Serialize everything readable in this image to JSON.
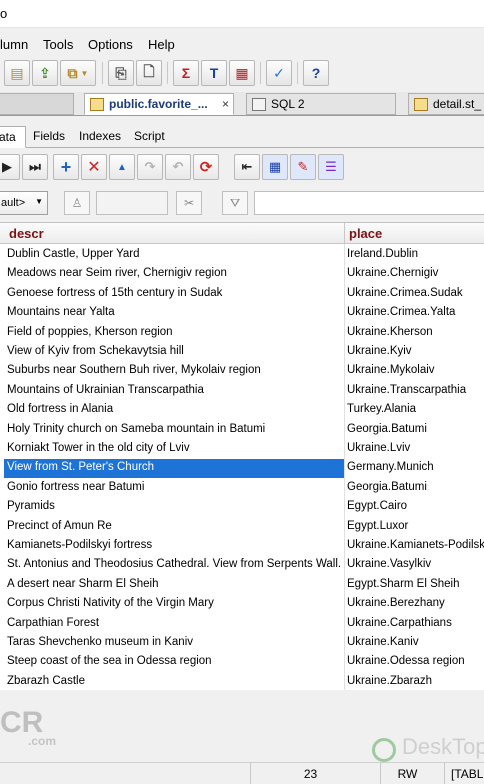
{
  "title_fragment": "o",
  "menu": [
    "lumn",
    "Tools",
    "Options",
    "Help"
  ],
  "doc_tabs": [
    {
      "label": "public.favorite_...",
      "close": "×"
    },
    {
      "label": "SQL 2"
    },
    {
      "label": "detail.st_"
    }
  ],
  "sub_tabs": [
    "ata",
    "Fields",
    "Indexes",
    "Script"
  ],
  "filter": {
    "combo_value": "ault>"
  },
  "grid": {
    "columns": [
      "descr",
      "place"
    ],
    "selected_row": 11,
    "rows": [
      [
        "Dublin Castle, Upper Yard",
        "Ireland.Dublin"
      ],
      [
        "Meadows near Seim river, Chernigiv region",
        "Ukraine.Chernigiv"
      ],
      [
        "Genoese fortress of 15th century in Sudak",
        "Ukraine.Crimea.Sudak"
      ],
      [
        "Mountains near Yalta",
        "Ukraine.Crimea.Yalta"
      ],
      [
        "Field of poppies, Kherson region",
        "Ukraine.Kherson"
      ],
      [
        "View of Kyiv from Schekavytsia hill",
        "Ukraine.Kyiv"
      ],
      [
        "Suburbs near Southern Buh river, Mykolaiv region",
        "Ukraine.Mykolaiv"
      ],
      [
        "Mountains of Ukrainian Transcarpathia",
        "Ukraine.Transcarpathia"
      ],
      [
        "Old fortress in Alania",
        "Turkey.Alania"
      ],
      [
        "Holy Trinity church on Sameba mountain in Batumi",
        "Georgia.Batumi"
      ],
      [
        "Korniakt Tower in the old city of Lviv",
        "Ukraine.Lviv"
      ],
      [
        "View from St. Peter's Church",
        "Germany.Munich"
      ],
      [
        "Gonio fortress near Batumi",
        "Georgia.Batumi"
      ],
      [
        "Pyramids",
        "Egypt.Cairo"
      ],
      [
        "Precinct of Amun Re",
        "Egypt.Luxor"
      ],
      [
        "Kamianets-Podilskyi fortress",
        "Ukraine.Kamianets-Podilsky"
      ],
      [
        "St. Antonius and Theodosius Cathedral. View from Serpents Wall.",
        "Ukraine.Vasylkiv"
      ],
      [
        "A desert near Sharm El Sheih",
        "Egypt.Sharm El Sheih"
      ],
      [
        "Corpus Christi Nativity of the Virgin Mary",
        "Ukraine.Berezhany"
      ],
      [
        "Carpathian Forest",
        "Ukraine.Carpathians"
      ],
      [
        "Taras Shevchenko museum in Kaniv",
        "Ukraine.Kaniv"
      ],
      [
        "Steep coast of the sea in Odessa region",
        "Ukraine.Odessa region"
      ],
      [
        "Zbarazh Castle",
        "Ukraine.Zbarazh"
      ]
    ]
  },
  "watermarks": {
    "left": "CR",
    "left_sub": ".com",
    "right": "DeskTop"
  },
  "status": {
    "count": "23",
    "mode": "RW",
    "extra": "[TABL"
  },
  "colors": {
    "selection": "#1e73d6",
    "header_text": "#7a1313",
    "active_tab_text": "#1b3b7a"
  }
}
